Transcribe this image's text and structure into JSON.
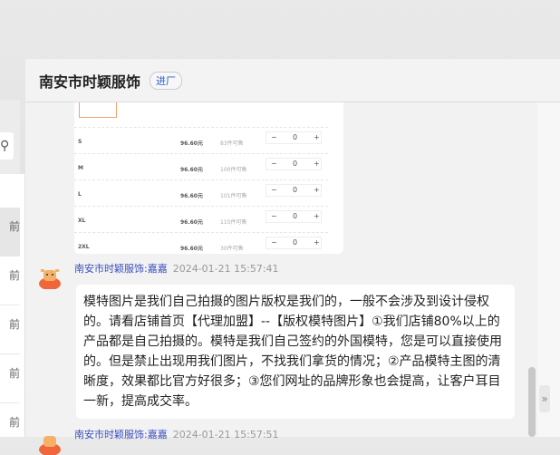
{
  "header": {
    "title": "南安市时颖服饰",
    "badge": "进厂"
  },
  "sidebar": {
    "search_icon": "search-icon",
    "items": [
      "前",
      "前",
      "前",
      "前",
      "前"
    ]
  },
  "product": {
    "rows": [
      {
        "size": "S",
        "price": "96.60元",
        "stock": "83件可售",
        "qty": "0"
      },
      {
        "size": "M",
        "price": "96.60元",
        "stock": "100件可售",
        "qty": "0"
      },
      {
        "size": "L",
        "price": "96.60元",
        "stock": "101件可售",
        "qty": "0"
      },
      {
        "size": "XL",
        "price": "96.60元",
        "stock": "115件可售",
        "qty": "0"
      },
      {
        "size": "2XL",
        "price": "96.60元",
        "stock": "30件可售",
        "qty": "0"
      }
    ],
    "minus": "−",
    "plus": "+"
  },
  "messages": [
    {
      "sender": "南安市时颖服饰:嘉嘉",
      "time": "2024-01-21 15:57:41",
      "text": "模特图片是我们自己拍摄的图片版权是我们的，一般不会涉及到设计侵权的。请看店铺首页【代理加盟】--【版权模特图片】①我们店铺80%以上的产品都是自己拍摄的。模特是我们自己签约的外国模特，您是可以直接使用的。但是禁止出现用我们图片，不找我们拿货的情况；②产品模特主图的清晰度，效果都比官方好很多；③您们网址的品牌形象也会提高，让客户耳目一新，提高成交率。"
    },
    {
      "sender": "南安市时颖服饰:嘉嘉",
      "time": "2024-01-21 15:57:51"
    }
  ],
  "expand_label": "»"
}
